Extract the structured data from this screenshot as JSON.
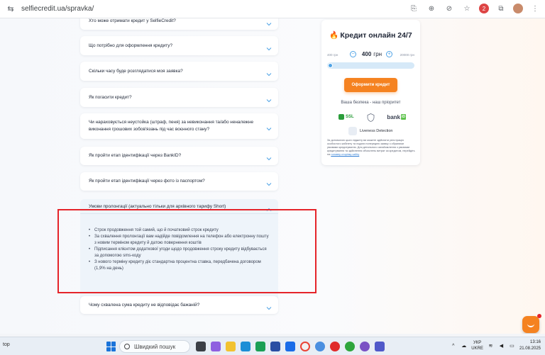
{
  "browser": {
    "url": "selfiecredit.ua/spravka/",
    "profile_badge": "2"
  },
  "faq": {
    "items": [
      {
        "question": "Хто може отримати кредит у SelfieCredit?"
      },
      {
        "question": "Що потрібно для оформлення кредиту?"
      },
      {
        "question": "Скільки часу буде розглядатися моя заявка?"
      },
      {
        "question": "Як погасити кредит?"
      },
      {
        "question": "Чи нараховується неустойка (штраф, пеня) за невиконання та/або неналежне виконання грошових зобов'язань під час воєнного стану?"
      },
      {
        "question": "Як пройти етап ідентифікації через BankID?"
      },
      {
        "question": "Як пройти етап ідентифікації через фото із паспортом?"
      }
    ],
    "open_item": {
      "question": "Умови пролонгації (актуально тільки для архівного тарифу Short)",
      "bullets": [
        "Строк продовження той самий, що й початковий строк кредиту",
        "За схвалення пролонгації вам надійде повідомлення на телефон або електронну пошту з новим терміном кредиту й датою повернення коштів",
        "Підписання клієнтом додаткової угоди щодо продовження строку кредиту відбувається за допомогою sms-коду",
        "З нового терміну кредиту діє стандартна процентна ставка, передбачена договором (1,9% на день)"
      ]
    },
    "last_item": {
      "question": "Чому схвалена сума кредиту не відповідає бажаній?"
    }
  },
  "widget": {
    "title": "Кредит онлайн 24/7",
    "min_label": "400 грн",
    "max_label": "20000 грн",
    "amount": "400",
    "currency": "грн",
    "slider_fraction": 0,
    "button_label": "Оформити кредит",
    "security_title": "Ваша безпека - наш пріоритет",
    "ssl_label": "SSL",
    "bank_label": "bank",
    "bank_id_label": "iD",
    "liveness_label": "Liveness Detection",
    "disclaimer": "За допомогою цього віджету ви можете здійснити реєстрацію особистого кабінету та подати попередню заявку з обраними умовами кредитування. Для детального ознайомлення з умовами кредитування та здійснення обчислень витрат за кредитом, перейдіть на",
    "disclaimer_link": "головну сторінку сайту"
  },
  "colors": {
    "accent": "#f58220",
    "slider": "#4fa3e6",
    "highlight": "#e5242a"
  },
  "taskbar": {
    "left_text": "top",
    "search_placeholder": "Швидкий пошук",
    "lang_line1": "УКР",
    "lang_line2": "UKRE",
    "time": "13:16",
    "date": "21.08.2025"
  }
}
